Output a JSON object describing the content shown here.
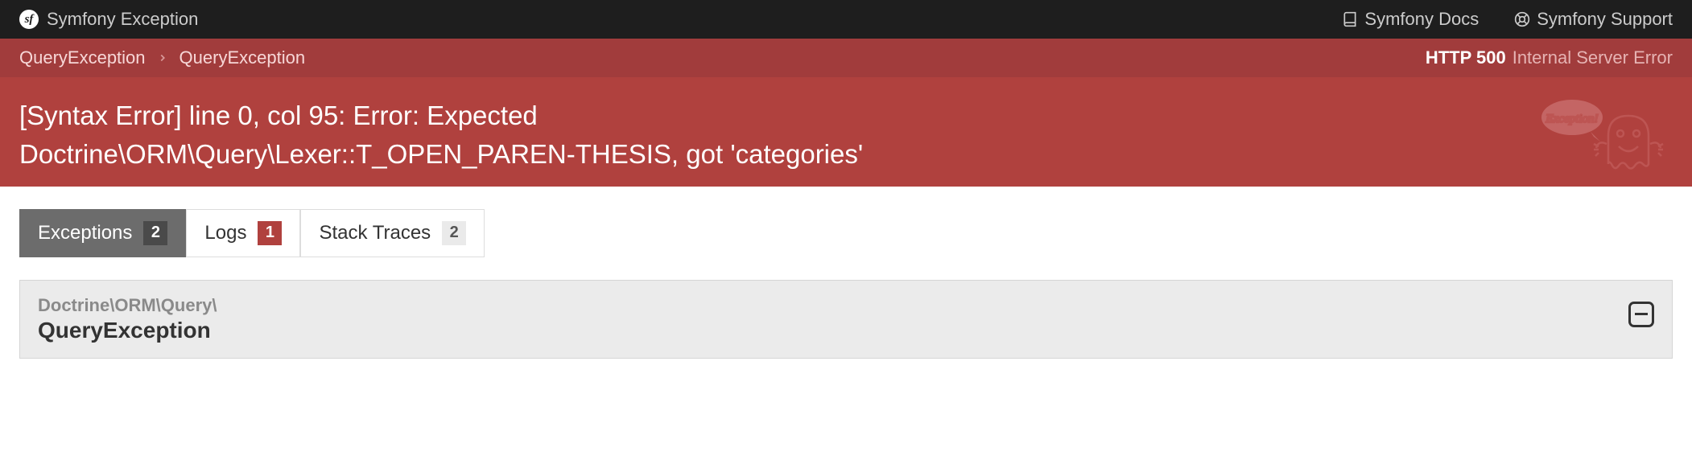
{
  "header": {
    "brand": "Symfony Exception",
    "links": {
      "docs": "Symfony Docs",
      "support": "Symfony Support"
    }
  },
  "breadcrumb": {
    "items": [
      "QueryException",
      "QueryException"
    ],
    "http_status_strong": "HTTP 500",
    "http_status_text": "Internal Server Error"
  },
  "error": {
    "message": "[Syntax Error] line 0, col 95: Error: Expected Doctrine\\ORM\\Query\\Lexer::T_OPEN_PAREN-THESIS, got 'categories'"
  },
  "tabs": [
    {
      "label": "Exceptions",
      "count": "2",
      "active": true,
      "badge_style": "dark"
    },
    {
      "label": "Logs",
      "count": "1",
      "active": false,
      "badge_style": "red"
    },
    {
      "label": "Stack Traces",
      "count": "2",
      "active": false,
      "badge_style": "light"
    }
  ],
  "exception_card": {
    "namespace": "Doctrine\\ORM\\Query\\",
    "class": "QueryException"
  },
  "icons": {
    "ghost_bubble": "Exception!"
  }
}
